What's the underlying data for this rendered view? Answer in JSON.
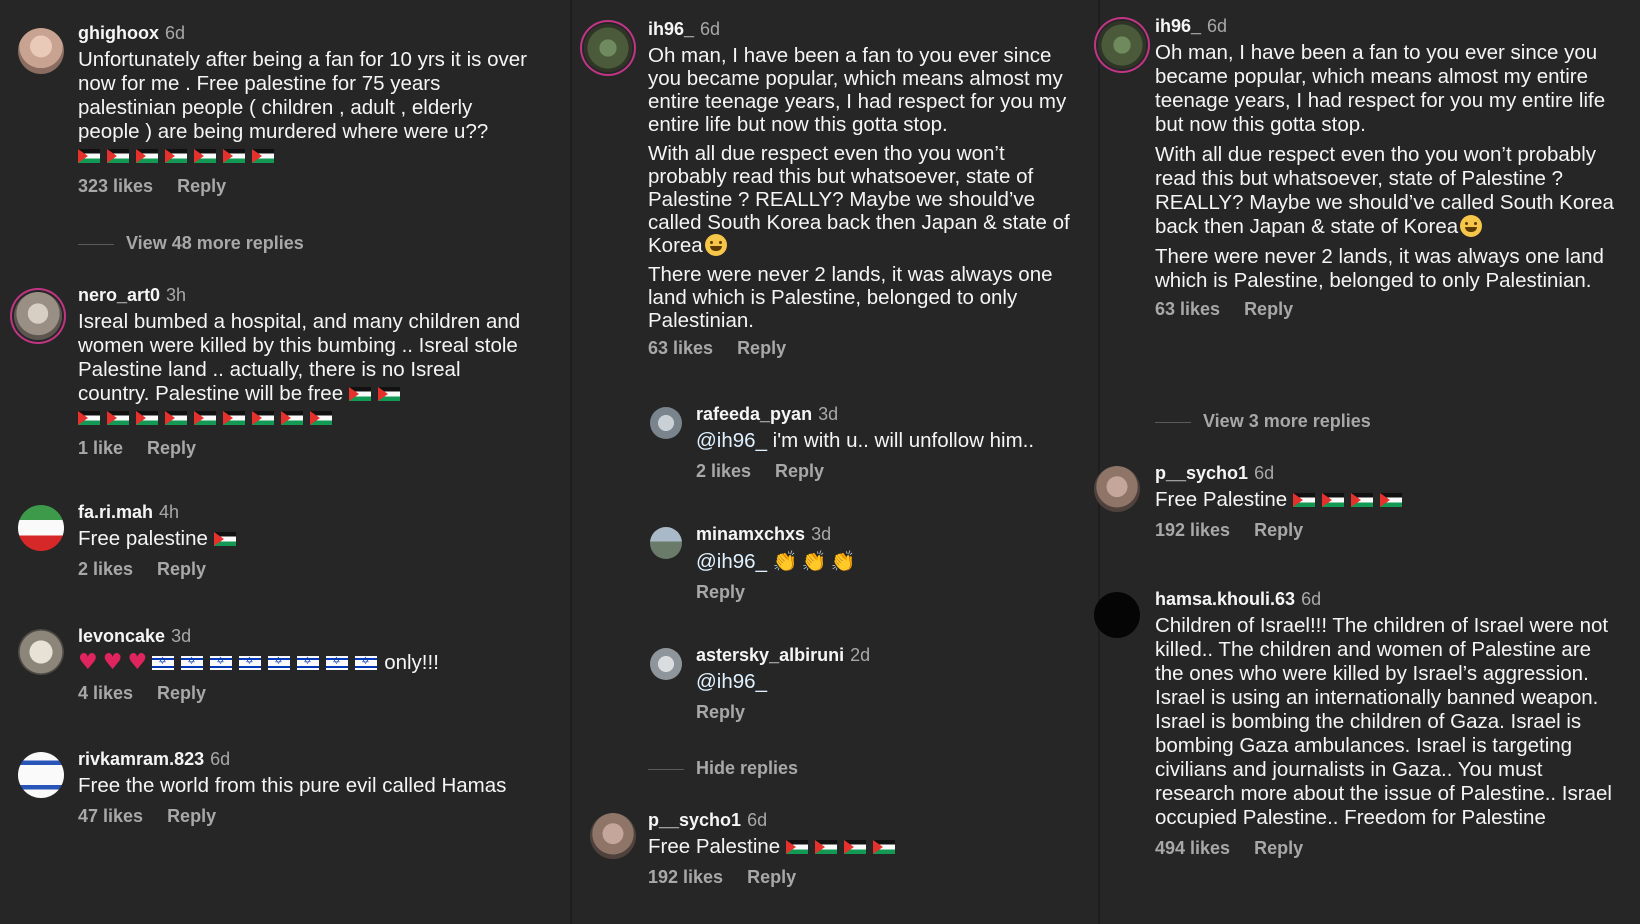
{
  "col1": {
    "c1": {
      "user": "ghighoox",
      "time": "6d",
      "text": "Unfortunately after being a fan for 10 yrs it is over now for me . Free palestine for 75 years palestinian people ( children , adult , elderly people ) are being murdered where were u??",
      "likes": "323 likes",
      "reply": "Reply"
    },
    "view_more": "View 48 more replies",
    "c2": {
      "user": "nero_art0",
      "time": "3h",
      "text": "Isreal bumbed a hospital, and many children and women were killed by this bumbing .. Isreal stole Palestine land .. actually, there is no Isreal country. Palestine will be free",
      "likes": "1 like",
      "reply": "Reply"
    },
    "c3": {
      "user": "fa.ri.mah",
      "time": "4h",
      "text": "Free palestine",
      "likes": "2 likes",
      "reply": "Reply"
    },
    "c4": {
      "user": "levoncake",
      "time": "3d",
      "text_suffix": "only!!!",
      "likes": "4 likes",
      "reply": "Reply"
    },
    "c5": {
      "user": "rivkamram.823",
      "time": "6d",
      "text": "Free the world from this pure evil called Hamas",
      "likes": "47 likes",
      "reply": "Reply"
    }
  },
  "col2": {
    "main": {
      "user": "ih96_",
      "time": "6d",
      "p1": "Oh man, I have been a fan to you ever since you became popular, which means almost my entire teenage years, I had respect for you my entire life but now this gotta stop.",
      "p2": "With all due respect even tho you won’t probably read this but whatsoever, state of Palestine ? REALLY? Maybe we should’ve called South Korea back then Japan & state of Korea",
      "p3": "There were never 2 lands, it was always one land which is Palestine, belonged to only Palestinian.",
      "likes": "63 likes",
      "reply": "Reply"
    },
    "r1": {
      "user": "rafeeda_pyan",
      "time": "3d",
      "mention": "@ih96_",
      "text": " i'm with u.. will unfollow him..",
      "likes": "2 likes",
      "reply": "Reply"
    },
    "r2": {
      "user": "minamxchxs",
      "time": "3d",
      "mention": "@ih96_",
      "reply": "Reply"
    },
    "r3": {
      "user": "astersky_albiruni",
      "time": "2d",
      "mention": "@ih96_",
      "reply": "Reply"
    },
    "hide": "Hide replies",
    "c5": {
      "user": "p__sycho1",
      "time": "6d",
      "text": "Free Palestine",
      "likes": "192 likes",
      "reply": "Reply"
    }
  },
  "col3": {
    "main": {
      "user": "ih96_",
      "time": "6d",
      "p1": "Oh man, I have been a fan to you ever since you became popular, which means almost my entire teenage years, I had respect for you my entire life but now this gotta stop.",
      "p2": "With all due respect even tho you won’t probably read this but whatsoever, state of Palestine ? REALLY? Maybe we should’ve called South Korea back then Japan & state of Korea",
      "p3": "There were never 2 lands, it was always one land which is Palestine, belonged to only Palestinian.",
      "likes": "63 likes",
      "reply": "Reply"
    },
    "view_more": "View 3 more replies",
    "c2": {
      "user": "p__sycho1",
      "time": "6d",
      "text": "Free Palestine",
      "likes": "192 likes",
      "reply": "Reply"
    },
    "c3": {
      "user": "hamsa.khouli.63",
      "time": "6d",
      "text": "Children of Israel!!! The children of Israel were not killed.. The children and women of Palestine are the ones who were killed by Israel’s aggression. Israel is using an internationally banned weapon. Israel is bombing the children of Gaza. Israel is bombing Gaza ambulances. Israel is targeting civilians and journalists in Gaza.. You must research more about the issue of Palestine.. Israel occupied Palestine.. Freedom for Palestine",
      "likes": "494 likes",
      "reply": "Reply"
    }
  },
  "colors": {
    "background": "#262626",
    "text": "#f5f5f5",
    "muted": "#a8a8a8",
    "story_ring": "#c13584"
  },
  "icons": [
    "palestine-flag-emoji",
    "israel-flag-emoji",
    "red-heart-emoji",
    "clapping-hands-emoji",
    "grinning-face-emoji"
  ]
}
